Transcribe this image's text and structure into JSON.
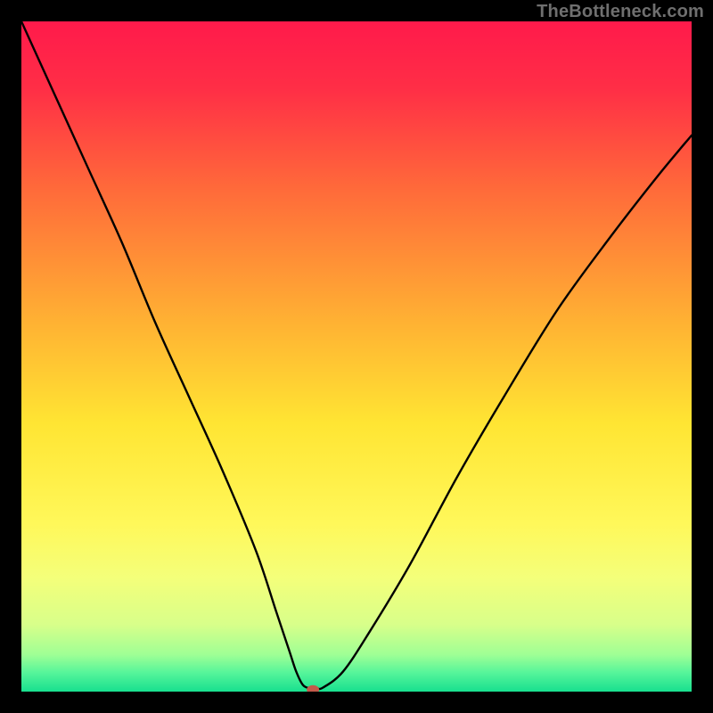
{
  "watermark": "TheBottleneck.com",
  "chart_data": {
    "type": "line",
    "title": "",
    "xlabel": "",
    "ylabel": "",
    "xlim": [
      0,
      100
    ],
    "ylim": [
      0,
      100
    ],
    "background_gradient": {
      "stops": [
        {
          "offset": 0.0,
          "color": "#ff1a4b"
        },
        {
          "offset": 0.1,
          "color": "#ff2e46"
        },
        {
          "offset": 0.25,
          "color": "#ff6a3a"
        },
        {
          "offset": 0.45,
          "color": "#ffb233"
        },
        {
          "offset": 0.6,
          "color": "#ffe533"
        },
        {
          "offset": 0.75,
          "color": "#fff85a"
        },
        {
          "offset": 0.83,
          "color": "#f4ff7a"
        },
        {
          "offset": 0.9,
          "color": "#d8ff8a"
        },
        {
          "offset": 0.945,
          "color": "#9FFF95"
        },
        {
          "offset": 0.972,
          "color": "#55F59A"
        },
        {
          "offset": 1.0,
          "color": "#18e08f"
        }
      ]
    },
    "series": [
      {
        "name": "bottleneck-curve",
        "color": "#000000",
        "x": [
          0,
          5,
          10,
          15,
          20,
          25,
          30,
          35,
          38,
          40,
          41,
          42,
          43,
          44,
          45,
          48,
          52,
          58,
          65,
          72,
          80,
          88,
          95,
          100
        ],
        "y": [
          100,
          89,
          78,
          67,
          55,
          44,
          33,
          21,
          12,
          6,
          3,
          1,
          0.5,
          0.5,
          0.6,
          3,
          9,
          19,
          32,
          44,
          57,
          68,
          77,
          83
        ]
      }
    ],
    "marker": {
      "name": "optimum-marker",
      "x": 43.5,
      "y": 0.3,
      "color": "#c35a4a",
      "rx": 7,
      "ry": 5
    }
  }
}
